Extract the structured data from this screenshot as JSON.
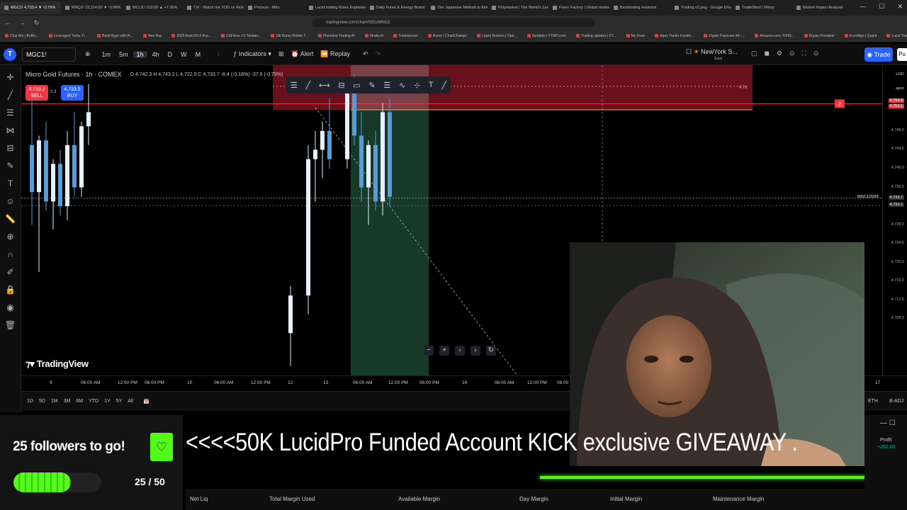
{
  "browser": {
    "tabs": [
      "MGC1! 4,733.4 ▼ -0.79%",
      "MNQ1! 23,314.00 ▼ -0.08%",
      "MCLI1! 103.00 ▲ +7.35%",
      "T.R - Watch the VOD on Kick",
      "Process - Miro",
      "Lucid trading Rules Explained",
      "Daily Forex & Energy Brand",
      "The Japanese Method to Elimin",
      "Polymarket | The World's Largest",
      "Forex Factory | Global markets fo",
      "Backtesting sessions",
      "Trading v2.png - Google Drive",
      "TradeStool | Whop",
      "Market Impact Analysis"
    ],
    "url": "tradingview.com/chart/GlGzMK62/",
    "bookmarks": [
      "Chat Bot | Botfor...",
      "Leveraged Turbo Tr...",
      "Build Apps with AI...",
      "Bee Ray",
      "2026 Audi RS 6 Ava...",
      "USFlens: #1 Taobao...",
      "Dill Dunin Mobile T...",
      "Hivemind Trading AI",
      "Stratis.fit",
      "Tradesyncer",
      "Home | ChartChamps",
      "Liquid Brokers | Ope...",
      "Symbols | FTMO.com",
      "Trading updates | FT...",
      "My Dues",
      "Apex Trader Fundin...",
      "Elgato Facecam 4K -...",
      "Amazon.com: FIFIN...",
      "Elgato Prompter",
      "KuroAlgo | Quant",
      "Lucid Trading - The...",
      "Elgato Stream Deck..."
    ]
  },
  "toolbar": {
    "symbol": "MGC1!",
    "intervals": [
      "1m",
      "5m",
      "1h",
      "4h",
      "D",
      "W",
      "M"
    ],
    "indicators": "Indicators",
    "alert": "Alert",
    "replay": "Replay",
    "session": "NewYork S...",
    "session_sub": "Save",
    "trade": "Trade",
    "pub": "Pu"
  },
  "legend": {
    "title": "Micro Gold Futures · 1h · COMEX",
    "ohlc": "O 4,742.3 H 4,743.2 L 4,722.5 C 4,733.7 -8.4 (-0.18%) -37.6 (-0.79%)",
    "sell_price": "4,733.2",
    "sell_label": "SELL",
    "spread": "0.3",
    "buy_price": "4,733.5",
    "buy_label": "BUY"
  },
  "chart_data": {
    "type": "candlestick",
    "symbol": "MGC1!",
    "interval": "1h",
    "price_axis": {
      "currency": "USD",
      "adjust": "apoz",
      "ticks": [
        4748.0,
        4744.0,
        4740.0,
        4736.0,
        4728.0,
        4724.0,
        4720.0,
        4716.0,
        4712.0,
        4708.0
      ]
    },
    "price_labels": {
      "zone_top": "4,754.3",
      "zone_bottom": "4,753.1",
      "crosshair": "4,733.7",
      "last": "4,732.1",
      "order_tag": "MGC1!2026"
    },
    "time_axis": [
      "9",
      "06:00 AM",
      "12:00 PM",
      "06:00 PM",
      "10",
      "06:00 AM",
      "12:00 PM",
      "12",
      "13",
      "06:00 AM",
      "12:00 PM",
      "06:00 PM",
      "14",
      "06:00 AM",
      "12:00 PM",
      "06:00",
      "17"
    ],
    "zone_label": "4 hr",
    "position_qty": "-2",
    "candles": [
      {
        "o": 4745,
        "h": 4757,
        "l": 4728,
        "c": 4735
      },
      {
        "o": 4735,
        "h": 4747,
        "l": 4718,
        "c": 4746
      },
      {
        "o": 4746,
        "h": 4750,
        "l": 4731,
        "c": 4733
      },
      {
        "o": 4733,
        "h": 4742,
        "l": 4727,
        "c": 4741
      },
      {
        "o": 4741,
        "h": 4744,
        "l": 4730,
        "c": 4732
      },
      {
        "o": 4732,
        "h": 4748,
        "l": 4729,
        "c": 4745
      },
      {
        "o": 4745,
        "h": 4752,
        "l": 4734,
        "c": 4736
      },
      {
        "o": 4736,
        "h": 4750,
        "l": 4734,
        "c": 4749
      },
      {
        "o": 4749,
        "h": 4758,
        "l": 4745,
        "c": 4752
      },
      {
        "o": 4705,
        "h": 4715,
        "l": 4698,
        "c": 4713
      },
      {
        "o": 4713,
        "h": 4745,
        "l": 4709,
        "c": 4742
      },
      {
        "o": 4742,
        "h": 4748,
        "l": 4733,
        "c": 4744
      },
      {
        "o": 4744,
        "h": 4750,
        "l": 4738,
        "c": 4748
      },
      {
        "o": 4748,
        "h": 4755,
        "l": 4740,
        "c": 4742
      },
      {
        "o": 4742,
        "h": 4759,
        "l": 4740,
        "c": 4757
      },
      {
        "o": 4757,
        "h": 4760,
        "l": 4745,
        "c": 4747
      },
      {
        "o": 4747,
        "h": 4752,
        "l": 4733,
        "c": 4736
      },
      {
        "o": 4736,
        "h": 4746,
        "l": 4728,
        "c": 4745
      },
      {
        "o": 4745,
        "h": 4748,
        "l": 4731,
        "c": 4733
      },
      {
        "o": 4733,
        "h": 4754,
        "l": 4730,
        "c": 4752
      },
      {
        "o": 4752,
        "h": 4755,
        "l": 4732,
        "c": 4734
      }
    ]
  },
  "watermark": "TradingView",
  "range_buttons": [
    "1D",
    "5D",
    "1M",
    "3M",
    "6M",
    "YTD",
    "1Y",
    "5Y",
    "All"
  ],
  "range_right": [
    "ETH",
    "B-ADJ"
  ],
  "overlay": {
    "followers_text": "25 followers to go!",
    "followers_count": "25 / 50",
    "followers_progress": 0.5,
    "giveaway": "<<<<50K LucidPro Funded Account KICK exclusive GIVEAWAY ."
  },
  "account_bar": {
    "fields": [
      "Net Liq",
      "Total Margin Used",
      "Available Margin",
      "Day Margin",
      "Initial Margin",
      "Maintenance Margin"
    ],
    "profit_label": "Profit",
    "profit_value": "+282.00"
  },
  "colors": {
    "up": "#e6f0ff",
    "down": "#5b9bd5",
    "zone": "#7a1320",
    "long_zone": "#1f4d33",
    "accent": "#2962ff",
    "kick": "#53fc18"
  }
}
